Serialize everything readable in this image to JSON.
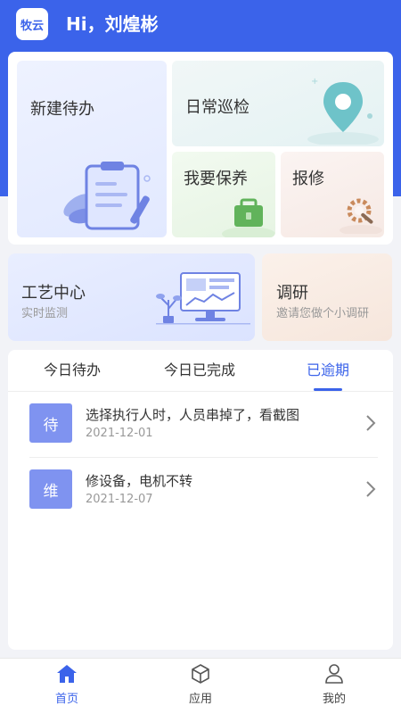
{
  "header": {
    "logo_text": "牧云",
    "greeting": "Hi，刘煌彬"
  },
  "quick_actions": {
    "new_todo": "新建待办",
    "daily_patrol": "日常巡检",
    "maintenance": "我要保养",
    "repair": "报修"
  },
  "banners": {
    "craft_title": "工艺中心",
    "craft_sub": "实时监测",
    "survey_title": "调研",
    "survey_sub": "邀请您做个小调研"
  },
  "tabs": [
    {
      "label": "今日待办"
    },
    {
      "label": "今日已完成"
    },
    {
      "label": "已逾期",
      "active": true
    }
  ],
  "tasks": [
    {
      "badge": "待",
      "title": "选择执行人时，人员串掉了，看截图",
      "date": "2021-12-01"
    },
    {
      "badge": "维",
      "title": "修设备，电机不转",
      "date": "2021-12-07"
    }
  ],
  "bottom_nav": [
    {
      "label": "首页",
      "icon": "home-icon",
      "active": true
    },
    {
      "label": "应用",
      "icon": "cube-icon"
    },
    {
      "label": "我的",
      "icon": "user-icon"
    }
  ],
  "colors": {
    "primary": "#3b63ea",
    "badge": "#7f93f0",
    "background": "#f2f3f7"
  }
}
